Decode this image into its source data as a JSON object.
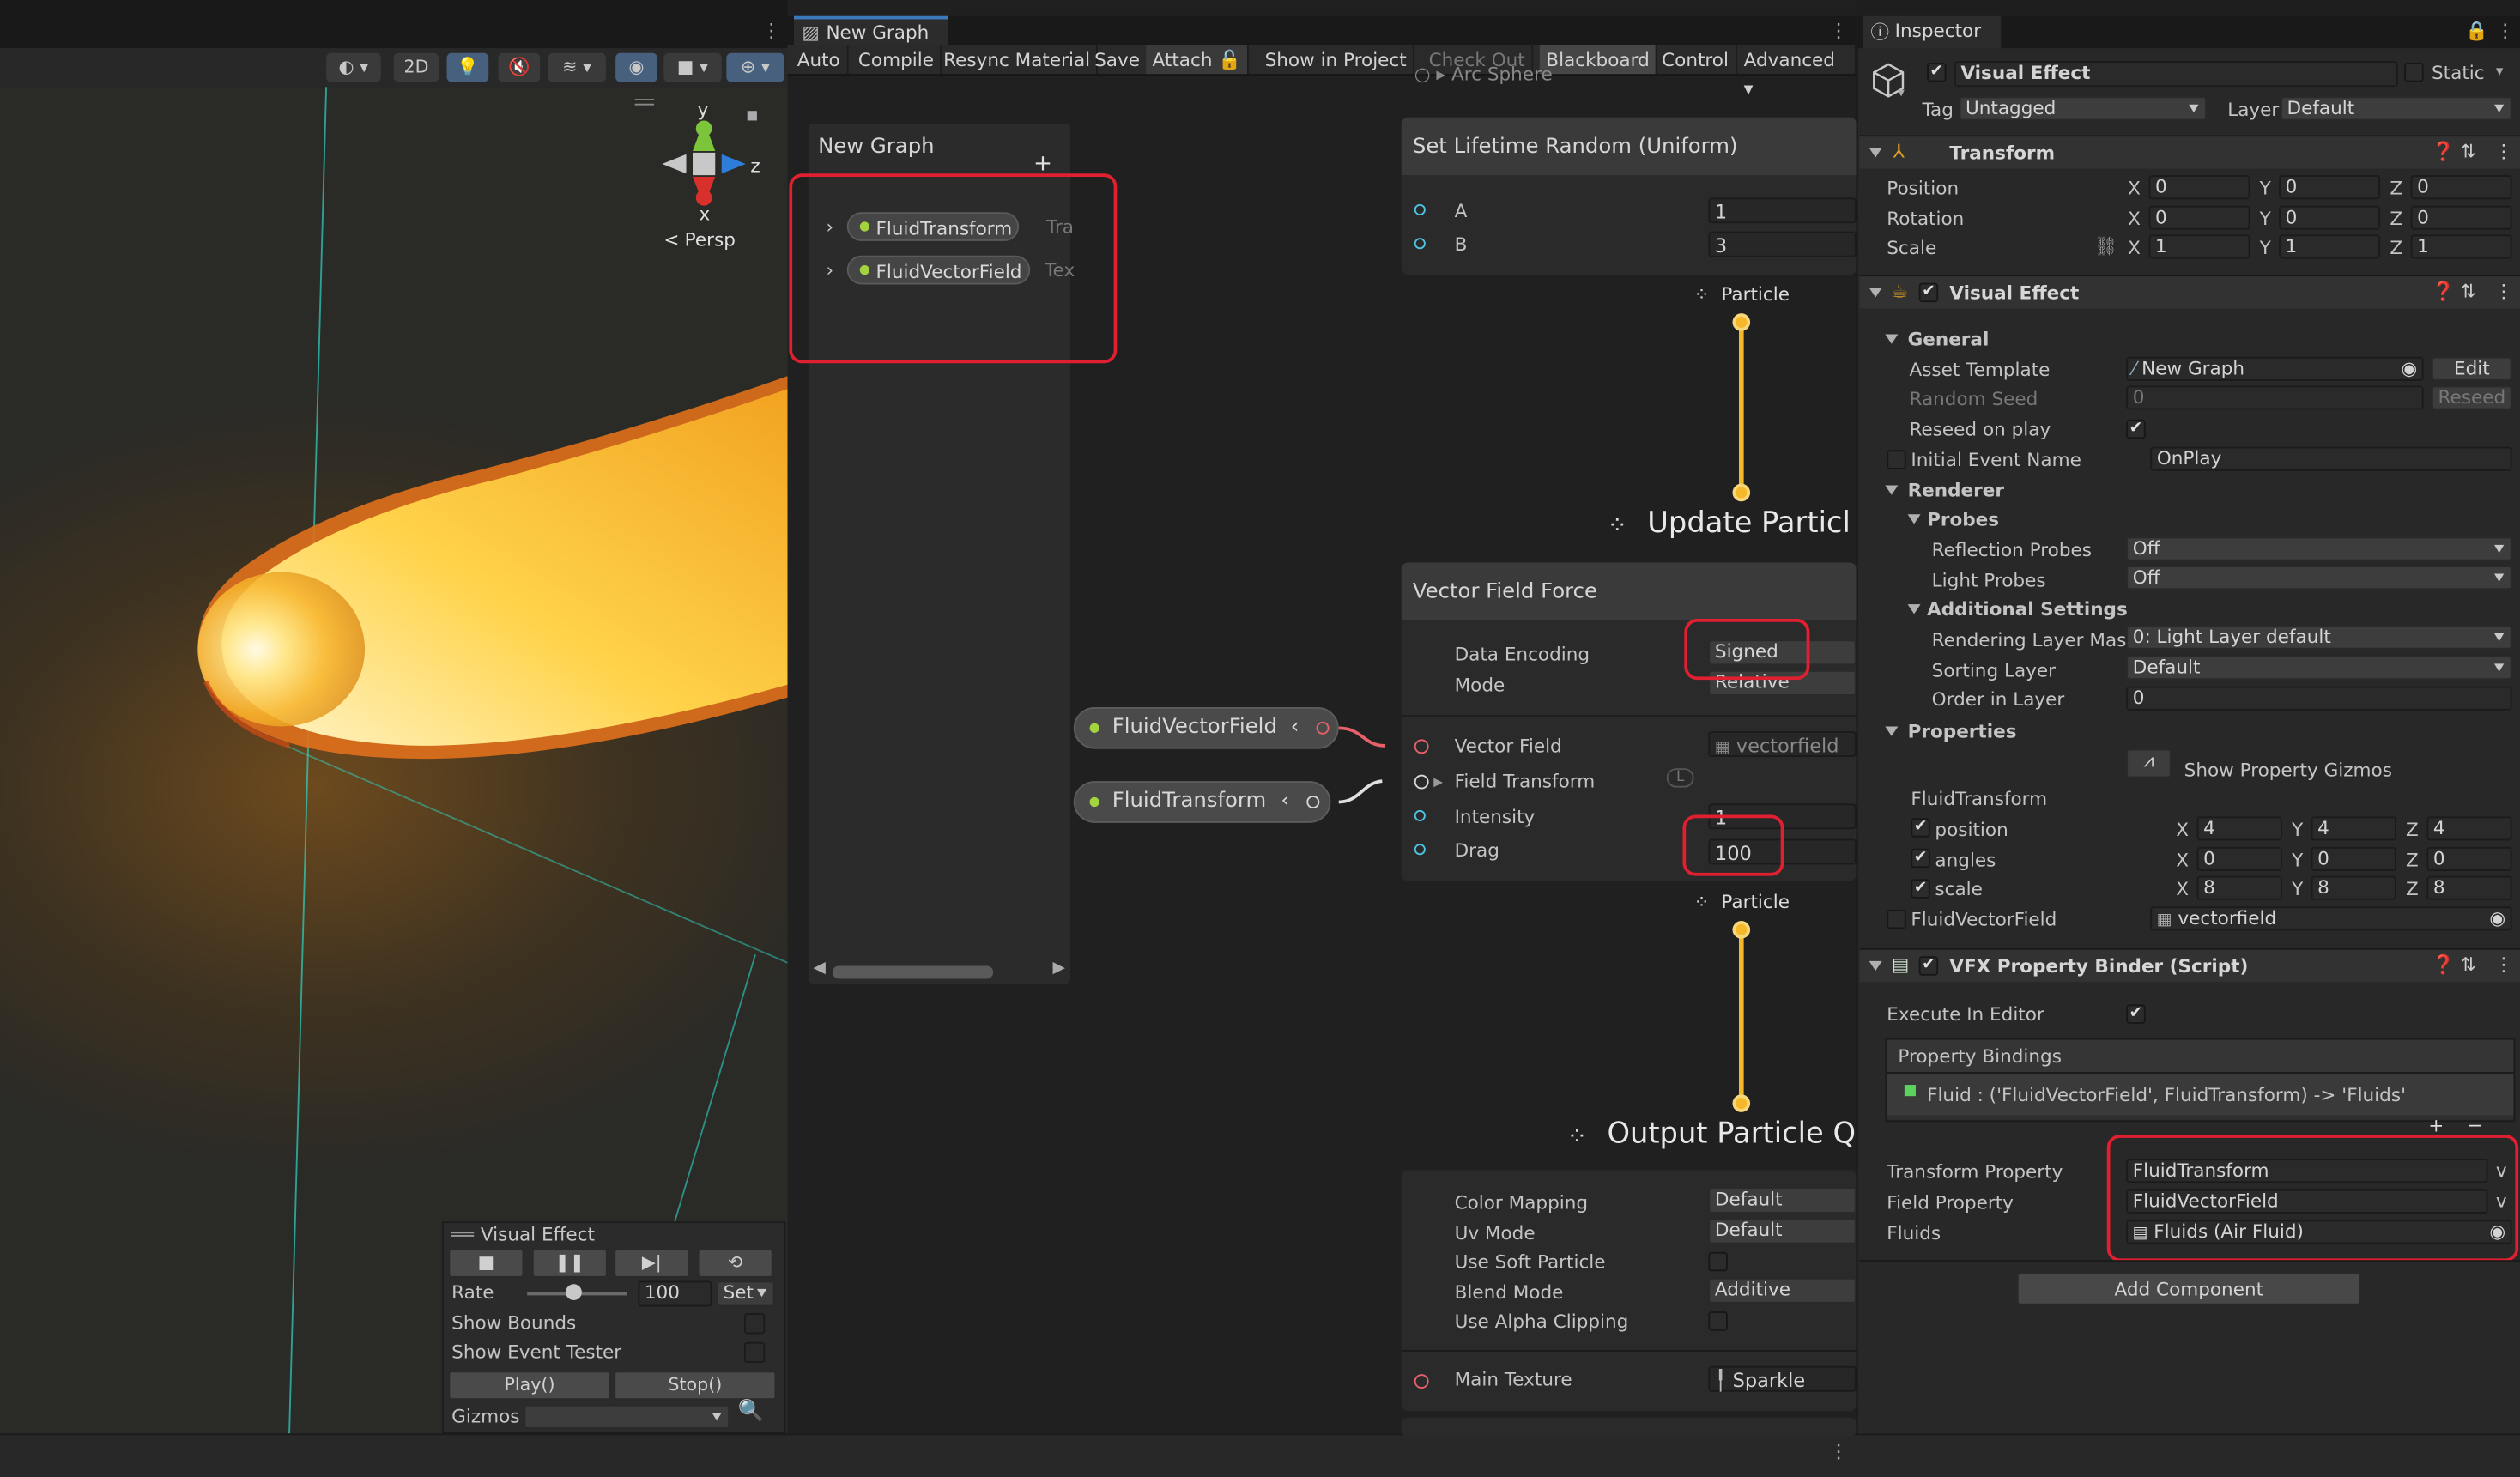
{
  "scene": {
    "toolbar": {
      "mode_2d": "2D"
    },
    "gizmo": {
      "axis_y": "y",
      "axis_z": "z",
      "axis_x": "x",
      "projection": "Persp"
    },
    "vfx_overlay": {
      "title": "Visual Effect",
      "rate_label": "Rate",
      "rate_value": "100",
      "set_label": "Set",
      "show_bounds_label": "Show Bounds",
      "show_event_tester_label": "Show Event Tester",
      "play_label": "Play()",
      "stop_label": "Stop()",
      "gizmos_label": "Gizmos"
    }
  },
  "graph": {
    "tab_title": "New Graph",
    "toolbar": [
      "Auto",
      "Compile",
      "Resync Material",
      "Save",
      "Attach",
      "Show in Project",
      "Check Out",
      "Blackboard",
      "Control",
      "Advanced"
    ],
    "blackboard": {
      "title": "New Graph",
      "add_symbol": "+",
      "properties": [
        {
          "name": "FluidTransform",
          "type_hint": "Tra"
        },
        {
          "name": "FluidVectorField",
          "type_hint": "Tex"
        }
      ]
    },
    "prop_nodes": {
      "vector_field": "FluidVectorField",
      "transform": "FluidTransform"
    },
    "arc_sphere_label": "Arc Sphere",
    "lifetime_node": {
      "title": "Set Lifetime Random (Uniform)",
      "a_label": "A",
      "a_value": "1",
      "b_label": "B",
      "b_value": "3"
    },
    "particle_label_1": "Particle",
    "update_context": "Update Particl",
    "vector_field_node": {
      "title": "Vector Field Force",
      "data_encoding_label": "Data Encoding",
      "data_encoding_value": "Signed",
      "mode_label": "Mode",
      "mode_value": "Relative",
      "vector_field_label": "Vector Field",
      "vector_field_value": "vectorfield",
      "field_transform_label": "Field Transform",
      "field_transform_badge": "L",
      "intensity_label": "Intensity",
      "intensity_value": "1",
      "drag_label": "Drag",
      "drag_value": "100"
    },
    "particle_label_2": "Particle",
    "output_context": "Output Particle Q",
    "output_node": {
      "color_mapping_label": "Color Mapping",
      "color_mapping_value": "Default",
      "uv_mode_label": "Uv Mode",
      "uv_mode_value": "Default",
      "use_soft_particle_label": "Use Soft Particle",
      "blend_mode_label": "Blend Mode",
      "blend_mode_value": "Additive",
      "use_alpha_clipping_label": "Use Alpha Clipping",
      "main_texture_label": "Main Texture",
      "main_texture_value": "Sparkle"
    }
  },
  "inspector": {
    "tab_title": "Inspector",
    "object_name": "Visual Effect",
    "static_label": "Static",
    "tag_label": "Tag",
    "tag_value": "Untagged",
    "layer_label": "Layer",
    "layer_value": "Default",
    "transform": {
      "title": "Transform",
      "position_label": "Position",
      "rotation_label": "Rotation",
      "scale_label": "Scale",
      "position": [
        "0",
        "0",
        "0"
      ],
      "rotation": [
        "0",
        "0",
        "0"
      ],
      "scale": [
        "1",
        "1",
        "1"
      ]
    },
    "visual_effect": {
      "title": "Visual Effect",
      "general_label": "General",
      "asset_template_label": "Asset Template",
      "asset_template_value": "New Graph",
      "edit_label": "Edit",
      "random_seed_label": "Random Seed",
      "random_seed_value": "0",
      "reseed_label": "Reseed",
      "reseed_on_play_label": "Reseed on play",
      "initial_event_label": "Initial Event Name",
      "initial_event_value": "OnPlay",
      "renderer_label": "Renderer",
      "probes_label": "Probes",
      "reflection_probes_label": "Reflection Probes",
      "reflection_probes_value": "Off",
      "light_probes_label": "Light Probes",
      "light_probes_value": "Off",
      "additional_settings_label": "Additional Settings",
      "rendering_layer_mask_label": "Rendering Layer Mask",
      "rendering_layer_mask_value": "0: Light Layer default",
      "sorting_layer_label": "Sorting Layer",
      "sorting_layer_value": "Default",
      "order_in_layer_label": "Order in Layer",
      "order_in_layer_value": "0",
      "properties_label": "Properties",
      "show_gizmos_label": "Show Property Gizmos",
      "fluid_transform_label": "FluidTransform",
      "position_label": "position",
      "position": [
        "4",
        "4",
        "4"
      ],
      "angles_label": "angles",
      "angles": [
        "0",
        "0",
        "0"
      ],
      "scale_label": "scale",
      "scale": [
        "8",
        "8",
        "8"
      ],
      "fluid_vector_field_label": "FluidVectorField",
      "fluid_vector_field_value": "vectorfield"
    },
    "binder": {
      "title": "VFX Property Binder (Script)",
      "execute_in_editor_label": "Execute In Editor",
      "bindings_label": "Property Bindings",
      "binding_entry": "Fluid : ('FluidVectorField', FluidTransform) -> 'Fluids'",
      "plus": "+",
      "minus": "−",
      "transform_property_label": "Transform Property",
      "transform_property_value": "FluidTransform",
      "field_property_label": "Field Property",
      "field_property_value": "FluidVectorField",
      "fluids_label": "Fluids",
      "fluids_value": "Fluids (Air Fluid)",
      "v_mark": "v"
    },
    "add_component_label": "Add Component"
  }
}
